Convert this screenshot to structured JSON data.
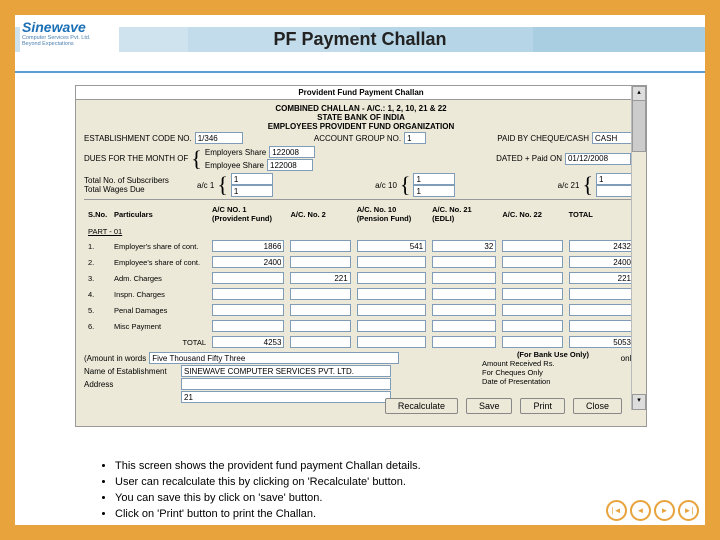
{
  "slide": {
    "brand_name": "Sinewave",
    "brand_sub1": "Computer Services Pvt. Ltd.",
    "brand_sub2": "Beyond Expectations",
    "title": "PF Payment Challan"
  },
  "app": {
    "window_title": "Provident Fund Payment Challan",
    "heading1": "COMBINED CHALLAN - A/C.: 1, 2, 10, 21 & 22",
    "heading2": "STATE BANK OF INDIA",
    "heading3": "EMPLOYEES PROVIDENT FUND ORGANIZATION",
    "est_code_lbl": "ESTABLISHMENT CODE NO.",
    "est_code_val": "1/346",
    "account_group_lbl": "ACCOUNT GROUP NO.",
    "account_group_val": "1",
    "paid_by_lbl": "PAID BY CHEQUE/CASH",
    "paid_by_val": "CASH",
    "month_lbl": "DUES FOR THE MONTH OF",
    "emp_contri_lbl": "Employers Share",
    "emp_contri_val": "122008",
    "emp_share_lbl": "Employee Share",
    "emp_share_val": "122008",
    "dated_on_lbl": "DATED + Paid ON",
    "dated_on_val": "01/12/2008",
    "sub_lbl": "Total No. of Subscribers",
    "wages_lbl": "Total Wages Due",
    "ac1_lbl": "a/c 1",
    "ac1_a": "1",
    "ac1_b": "1",
    "ac10_lbl": "a/c 10",
    "ac10_a": "1",
    "ac10_b": "1",
    "ac21_lbl": "a/c 21",
    "ac21_a": "1",
    "ac21_b": " ",
    "col_sno": "S.No.",
    "col_part": "Particulars",
    "col_ac1": "A/C NO. 1",
    "col_ac1_sub": "(Provident Fund)",
    "col_ac2": "A/C. No. 2",
    "col_ac10": "A/C. No. 10",
    "col_ac10_sub": "(Pension Fund)",
    "col_ac21": "A/C. No. 21",
    "col_ac21_sub": "(EDLI)",
    "col_ac22": "A/C. No. 22",
    "col_total": "TOTAL",
    "part_hdr": "PART - 01",
    "rows": [
      {
        "n": "1.",
        "p": "Employer's share of cont.",
        "v1": "1866",
        "v10": "541",
        "v21": "32",
        "tot": "2432"
      },
      {
        "n": "2.",
        "p": "Employee's share of cont.",
        "v1": "2400",
        "tot": "2400"
      },
      {
        "n": "3.",
        "p": "Adm. Charges",
        "v2": "221",
        "tot": "221"
      },
      {
        "n": "4.",
        "p": "Inspn. Charges"
      },
      {
        "n": "5.",
        "p": "Penal Damages"
      },
      {
        "n": "6.",
        "p": "Misc Payment"
      }
    ],
    "total_lbl": "TOTAL",
    "total_v1": "4253",
    "total_tot": "5053",
    "words_lbl": "(Amount in words",
    "words_val": "Five Thousand Fifty Three",
    "words_suf": "only)",
    "name_est_lbl": "Name of Establishment",
    "name_est_val": "SINEWAVE COMPUTER SERVICES PVT. LTD.",
    "addr_lbl": "Address",
    "addr_val": " ",
    "addr2_val": "21",
    "bank_hdr": "(For Bank Use Only)",
    "bank_1": "Amount Received Rs.",
    "bank_2": "For Cheques Only",
    "bank_3": "Date of Presentation",
    "btn_recalc": "Recalculate",
    "btn_save": "Save",
    "btn_print": "Print",
    "btn_close": "Close"
  },
  "bullets": [
    "This screen shows the provident fund  payment Challan details.",
    "User can recalculate this by clicking on 'Recalculate' button.",
    "You can save this by click on 'save' button.",
    "Click on 'Print' button to print the Challan."
  ],
  "nav": {
    "first": "|◄",
    "prev": "◄",
    "next": "►",
    "last": "►|"
  }
}
